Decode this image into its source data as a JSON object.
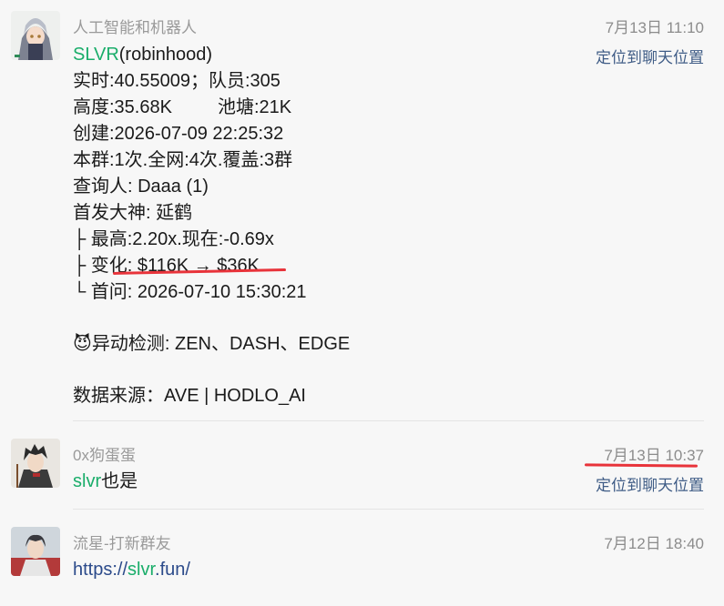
{
  "messages": [
    {
      "sender": "人工智能和机器人",
      "time": "7月13日 11:10",
      "locate_label": "定位到聊天位置",
      "token_symbol": "SLVR",
      "token_suffix": "(robinhood)",
      "lines": [
        "实时:40.55009；队员:305",
        "高度:35.68K         池塘:21K",
        "创建:2026-07-09 22:25:32",
        "本群:1次.全网:4次.覆盖:3群",
        "查询人: Daaa (1)",
        "首发大神: 延鹤",
        "├ 最高:2.20x.现在:-0.69x",
        "├ 变化: $116K → $36K",
        "└ 首问: 2026-07-10 15:30:21"
      ],
      "alert_icon": "😈",
      "alert_text": "异动检测: ZEN、DASH、EDGE",
      "source_text": "数据来源：AVE | HODLO_AI"
    },
    {
      "sender": "0x狗蛋蛋",
      "time": "7月13日 10:37",
      "locate_label": "定位到聊天位置",
      "text_green": "slvr",
      "text_rest": "也是"
    },
    {
      "sender": "流星-打新群友",
      "time": "7月12日 18:40",
      "link_prefix": "https://",
      "link_green": "slvr",
      "link_suffix": ".fun/"
    }
  ],
  "colors": {
    "accent_green": "#1aad6a",
    "link_blue": "#3f5c86",
    "annotation_red": "#e8333a"
  },
  "icons": [
    "robot-girl-avatar",
    "samurai-avatar",
    "anime-boy-avatar",
    "devil-emoji"
  ]
}
